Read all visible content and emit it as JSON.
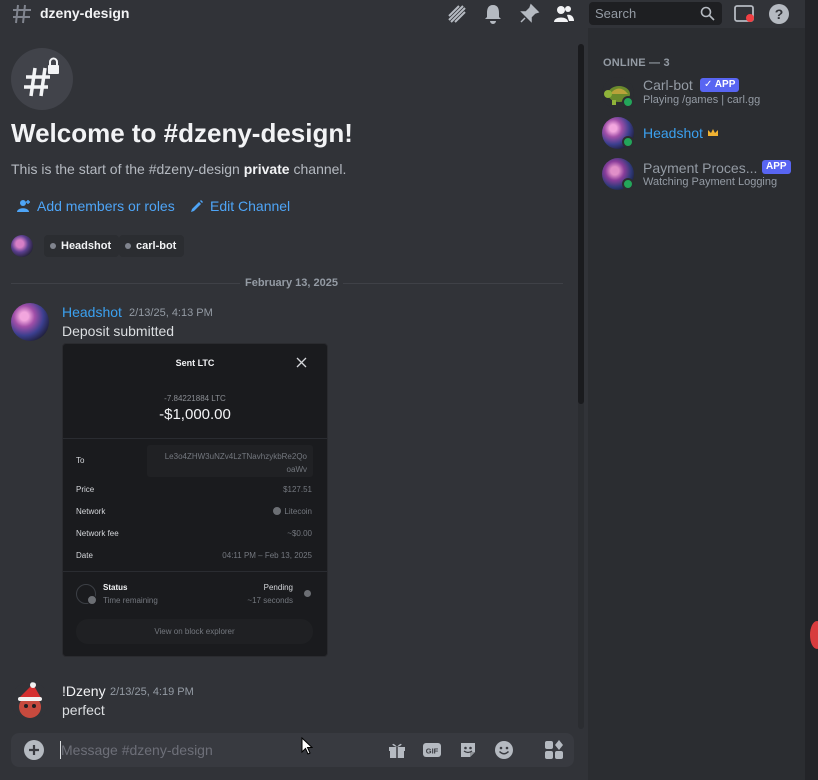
{
  "header": {
    "channel_name": "dzeny-design",
    "search_placeholder": "Search"
  },
  "welcome": {
    "title": "Welcome to #dzeny-design!",
    "subtitle_pre": "This is the start of the #dzeny-design ",
    "subtitle_bold": "private",
    "subtitle_post": " channel.",
    "add_members_label": "Add members or roles",
    "edit_channel_label": "Edit Channel",
    "chips": [
      "Headshot",
      "carl-bot"
    ]
  },
  "date_divider": "February 13, 2025",
  "messages": [
    {
      "author": "Headshot",
      "author_color": "#3ba1f0",
      "time": "2/13/25, 4:13 PM",
      "text": "Deposit submitted"
    },
    {
      "author": "!Dzeny",
      "author_color": "#f2f3f5",
      "time": "2/13/25, 4:19 PM",
      "text": "perfect"
    }
  ],
  "transaction": {
    "title": "Sent LTC",
    "amount_crypto": "-7.84221884 LTC",
    "amount_fiat": "-$1,000.00",
    "to_label": "To",
    "to_address_line1": "Le3o4ZHW3uNZv4LzTNavhzykbRe2Qo",
    "to_address_line2": "oaWv",
    "price_label": "Price",
    "price_value": "$127.51",
    "network_label": "Network",
    "network_value": "Litecoin",
    "fee_label": "Network fee",
    "fee_value": "~$0.00",
    "date_label": "Date",
    "date_value": "04:11 PM – Feb 13, 2025",
    "status_label": "Status",
    "status_value": "Pending",
    "remaining_label": "Time remaining",
    "remaining_value": "~17 seconds",
    "explorer_label": "View on block explorer"
  },
  "composer": {
    "placeholder": "Message #dzeny-design"
  },
  "members": {
    "heading": "ONLINE — 3",
    "list": [
      {
        "name": "Carl-bot",
        "badge": "APP",
        "activity": "Playing /games | carl.gg"
      },
      {
        "name": "Headshot",
        "badge": "",
        "activity": ""
      },
      {
        "name": "Payment Proces...",
        "badge": "APP",
        "activity": "Watching Payment Logging"
      }
    ]
  },
  "colors": {
    "accent_link": "#4ea5f7",
    "online": "#23a55a",
    "app_badge": "#5865f2"
  }
}
